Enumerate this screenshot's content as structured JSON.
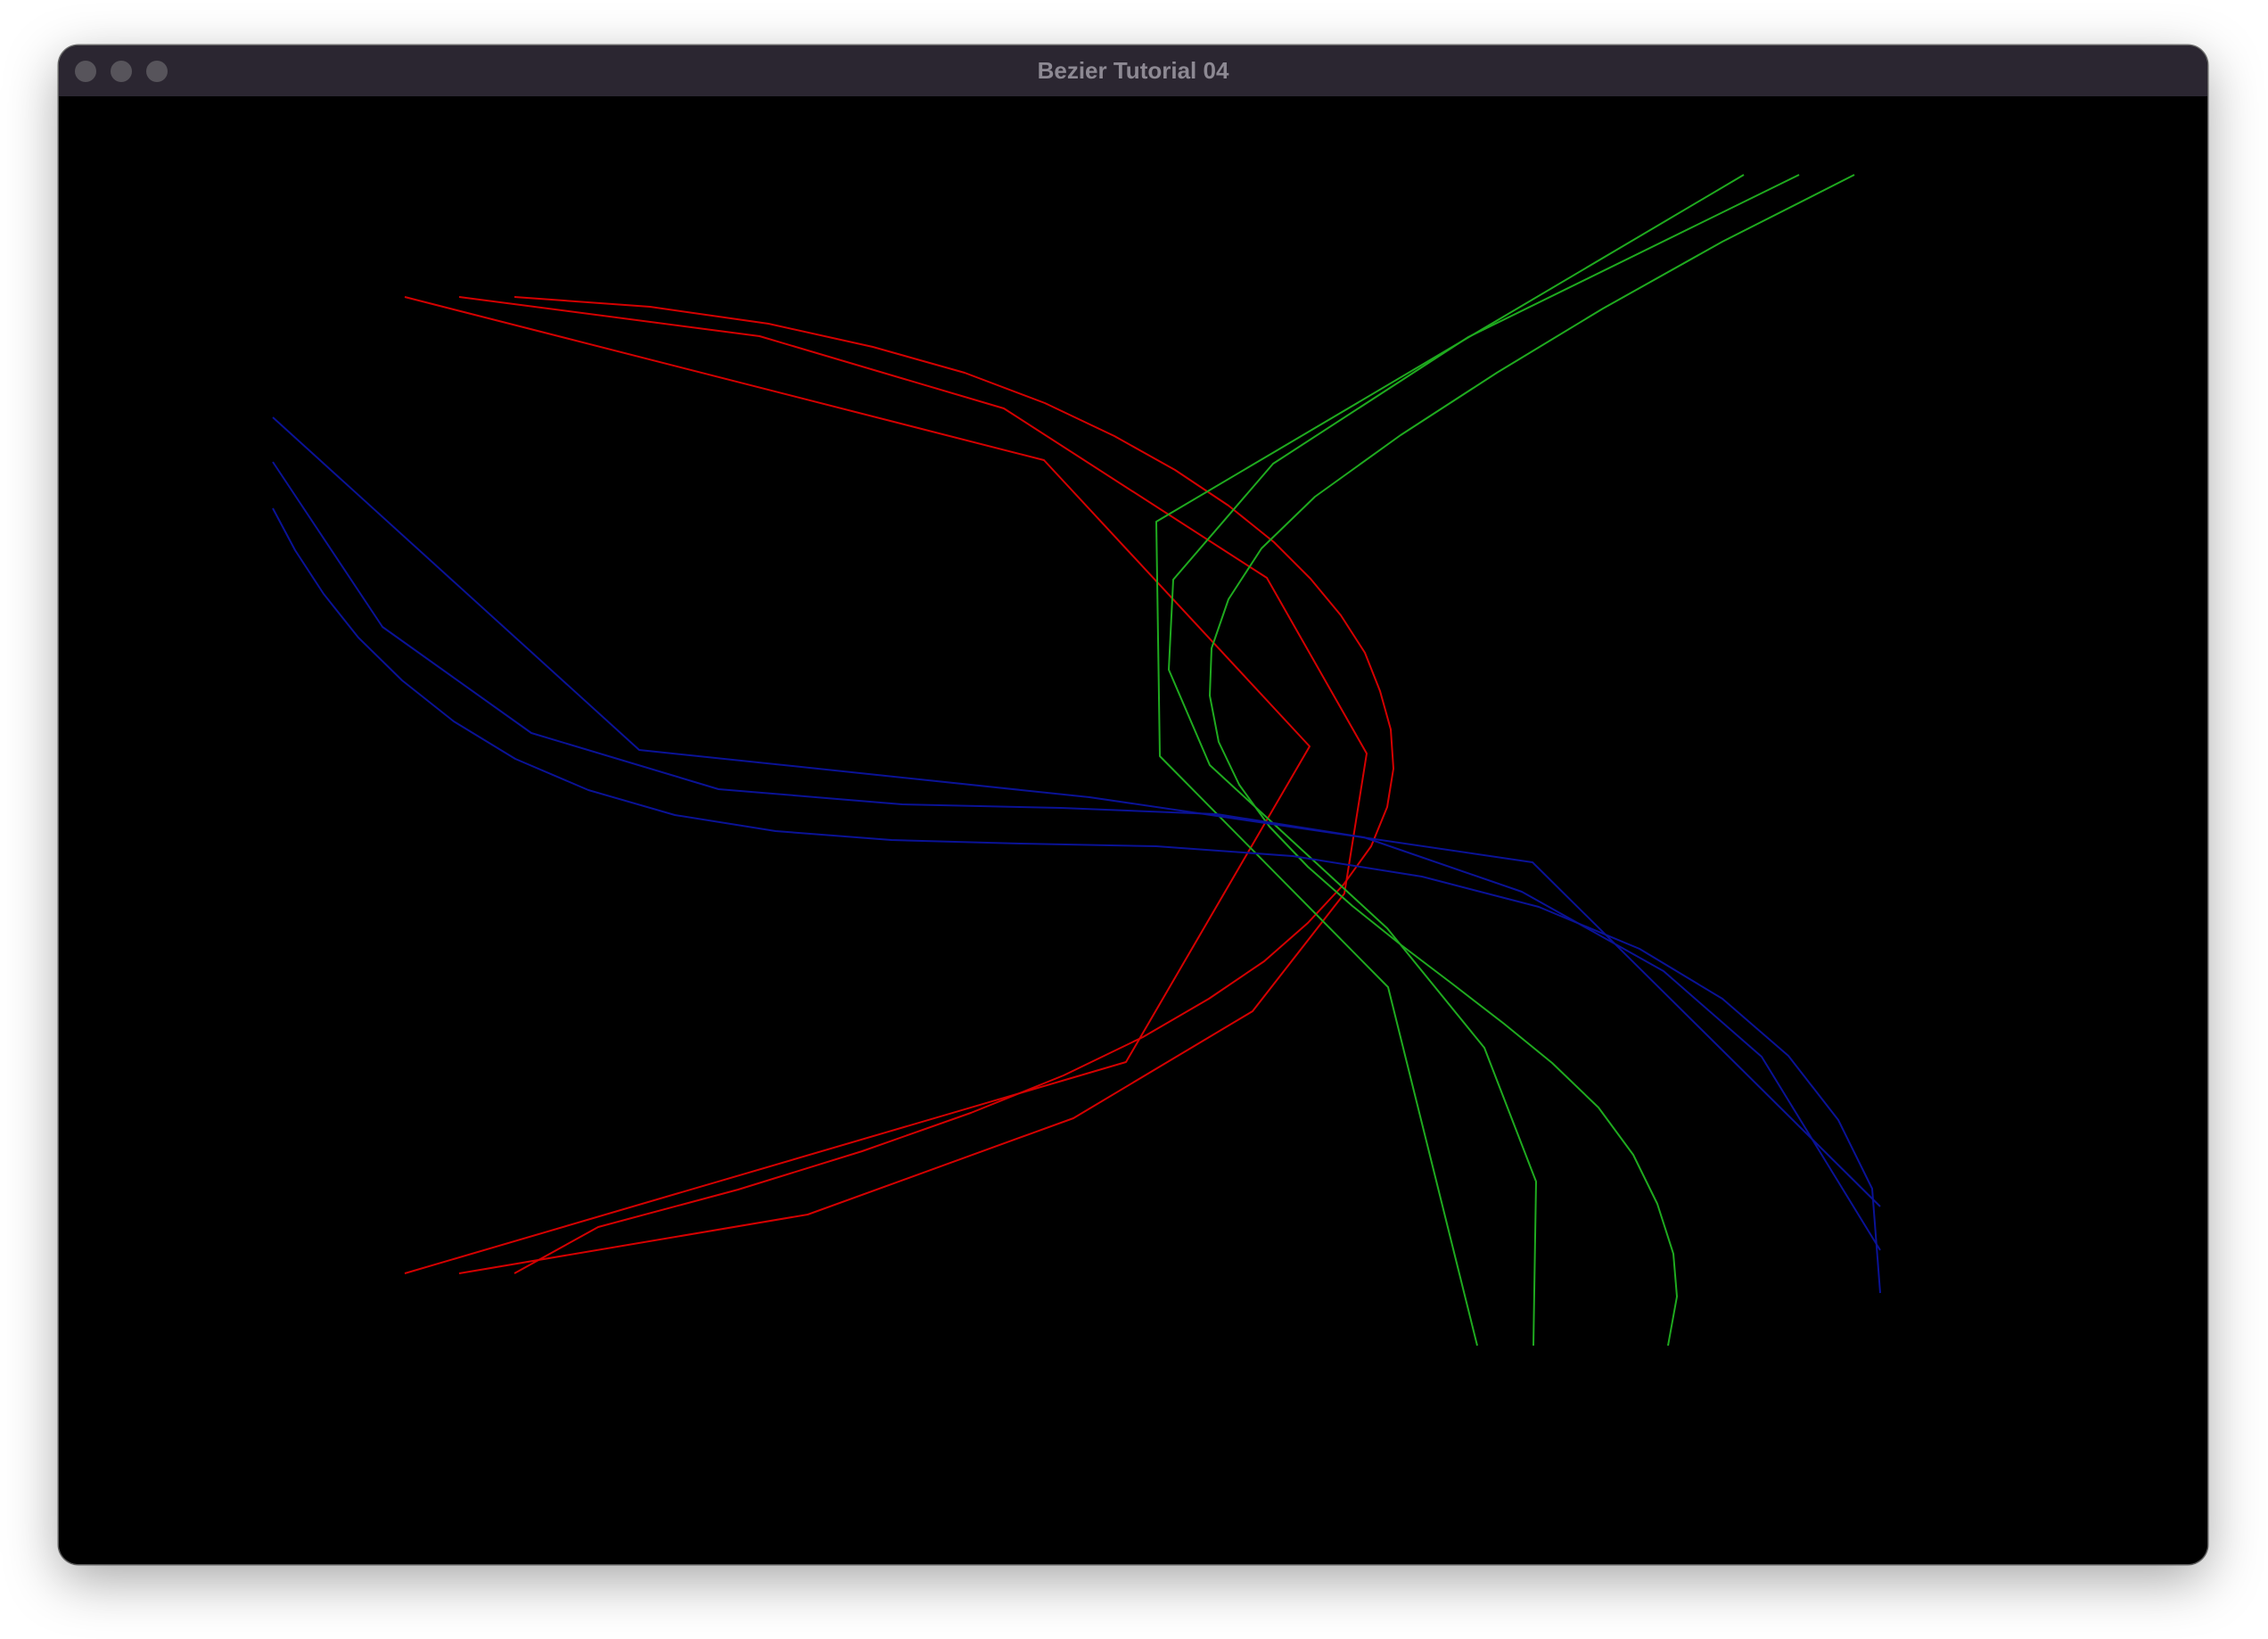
{
  "window": {
    "title": "Bezier Tutorial 04",
    "traffic_lights": [
      "close",
      "minimize",
      "maximize"
    ],
    "traffic_light_color": "#57545b",
    "titlebar_color": "#2b2631",
    "title_color": "#8d8993"
  },
  "canvas": {
    "background": "#000000",
    "curves": [
      {
        "name": "red",
        "color": "#d40000",
        "polylines": [
          [
            [
              454,
              333
            ],
            [
              1171,
              516
            ],
            [
              1469,
              837
            ],
            [
              1263,
              1191
            ],
            [
              454,
              1428
            ]
          ],
          [
            [
              515,
              333
            ],
            [
              852,
              377
            ],
            [
              1126,
              458
            ],
            [
              1421,
              648
            ],
            [
              1533,
              845
            ],
            [
              1508,
              1002
            ],
            [
              1405,
              1134
            ],
            [
              1204,
              1254
            ],
            [
              906,
              1362
            ],
            [
              515,
              1428
            ]
          ],
          [
            [
              577,
              333
            ],
            [
              729,
              344
            ],
            [
              862,
              363
            ],
            [
              979,
              389
            ],
            [
              1082,
              418
            ],
            [
              1172,
              452
            ],
            [
              1250,
              489
            ],
            [
              1318,
              527
            ],
            [
              1378,
              567
            ],
            [
              1429,
              608
            ],
            [
              1470,
              649
            ],
            [
              1504,
              690
            ],
            [
              1531,
              732
            ],
            [
              1548,
              775
            ],
            [
              1560,
              818
            ],
            [
              1563,
              862
            ],
            [
              1556,
              905
            ],
            [
              1538,
              949
            ],
            [
              1507,
              992
            ],
            [
              1467,
              1035
            ],
            [
              1418,
              1078
            ],
            [
              1356,
              1120
            ],
            [
              1282,
              1163
            ],
            [
              1193,
              1206
            ],
            [
              1089,
              1248
            ],
            [
              967,
              1291
            ],
            [
              828,
              1334
            ],
            [
              671,
              1376
            ],
            [
              577,
              1428
            ]
          ]
        ]
      },
      {
        "name": "green",
        "color": "#1faa1f",
        "polylines": [
          [
            [
              1956,
              196
            ],
            [
              1297,
              585
            ],
            [
              1301,
              848
            ],
            [
              1557,
              1107
            ],
            [
              1657,
              1509
            ]
          ],
          [
            [
              2018,
              196
            ],
            [
              1647,
              378
            ],
            [
              1428,
              520
            ],
            [
              1316,
              650
            ],
            [
              1311,
              751
            ],
            [
              1357,
              858
            ],
            [
              1556,
              1041
            ],
            [
              1665,
              1175
            ],
            [
              1723,
              1325
            ],
            [
              1720,
              1509
            ]
          ],
          [
            [
              2080,
              196
            ],
            [
              1932,
              271
            ],
            [
              1798,
              346
            ],
            [
              1679,
              418
            ],
            [
              1571,
              488
            ],
            [
              1475,
              557
            ],
            [
              1415,
              615
            ],
            [
              1378,
              672
            ],
            [
              1359,
              727
            ],
            [
              1357,
              780
            ],
            [
              1367,
              832
            ],
            [
              1390,
              880
            ],
            [
              1424,
              927
            ],
            [
              1467,
              972
            ],
            [
              1517,
              1016
            ],
            [
              1572,
              1060
            ],
            [
              1630,
              1104
            ],
            [
              1687,
              1148
            ],
            [
              1741,
              1192
            ],
            [
              1793,
              1242
            ],
            [
              1832,
              1295
            ],
            [
              1859,
              1350
            ],
            [
              1877,
              1406
            ],
            [
              1881,
              1454
            ],
            [
              1871,
              1509
            ]
          ]
        ]
      },
      {
        "name": "blue",
        "color": "#0a1296",
        "polylines": [
          [
            [
              306,
              468
            ],
            [
              717,
              841
            ],
            [
              1222,
              894
            ],
            [
              1719,
              967
            ],
            [
              2109,
              1353
            ]
          ],
          [
            [
              306,
              518
            ],
            [
              429,
              703
            ],
            [
              596,
              822
            ],
            [
              806,
              885
            ],
            [
              1012,
              902
            ],
            [
              1190,
              906
            ],
            [
              1365,
              913
            ],
            [
              1530,
              939
            ],
            [
              1707,
              1000
            ],
            [
              1866,
              1089
            ],
            [
              1976,
              1185
            ],
            [
              2109,
              1402
            ]
          ],
          [
            [
              306,
              570
            ],
            [
              331,
              617
            ],
            [
              363,
              666
            ],
            [
              402,
              715
            ],
            [
              451,
              763
            ],
            [
              509,
              809
            ],
            [
              578,
              851
            ],
            [
              660,
              886
            ],
            [
              757,
              914
            ],
            [
              870,
              932
            ],
            [
              1000,
              942
            ],
            [
              1145,
              946
            ],
            [
              1297,
              949
            ],
            [
              1450,
              960
            ],
            [
              1595,
              983
            ],
            [
              1726,
              1017
            ],
            [
              1839,
              1064
            ],
            [
              1932,
              1120
            ],
            [
              2006,
              1184
            ],
            [
              2062,
              1256
            ],
            [
              2100,
              1333
            ],
            [
              2109,
              1450
            ]
          ]
        ]
      }
    ]
  }
}
